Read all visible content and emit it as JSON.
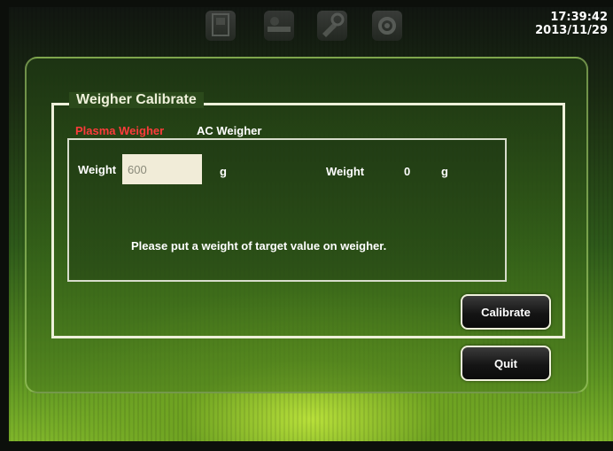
{
  "clock": {
    "time": "17:39:42",
    "date": "2013/11/29"
  },
  "toolbar_icons": [
    "machine-icon",
    "desk-icon",
    "tools-icon",
    "settings-icon"
  ],
  "dialog": {
    "title": "Weigher Calibrate",
    "tabs": [
      {
        "label": "Plasma Weigher",
        "active": true
      },
      {
        "label": "AC Weigher",
        "active": false
      }
    ],
    "target_weight": {
      "label": "Weight",
      "value": "600",
      "unit": "g"
    },
    "current_weight": {
      "label": "Weight",
      "value": "0",
      "unit": "g"
    },
    "message": "Please put a weight of target value on weigher.",
    "calibrate_label": "Calibrate",
    "quit_label": "Quit"
  },
  "colors": {
    "active_tab": "#ff3b3b",
    "text": "#ffffff",
    "frame": "#eef0da"
  }
}
